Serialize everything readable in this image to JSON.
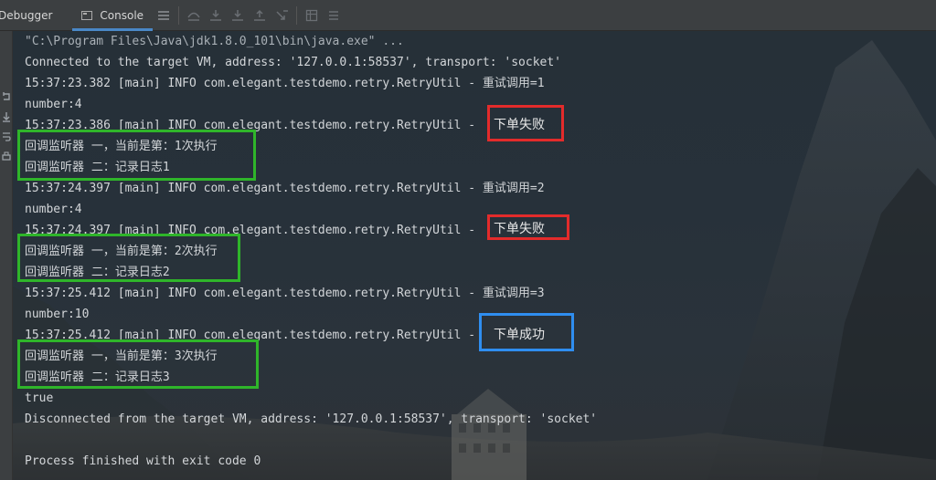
{
  "tabs": {
    "debugger": "Debugger",
    "console": "Console"
  },
  "toolbar_icons": [
    "menu-icon",
    "step-over-icon",
    "step-into-icon",
    "force-step-into-icon",
    "step-out-icon",
    "run-to-cursor-icon",
    "evaluate-icon",
    "frames-icon"
  ],
  "console": {
    "lines": [
      "\"C:\\Program Files\\Java\\jdk1.8.0_101\\bin\\java.exe\" ...",
      "Connected to the target VM, address: '127.0.0.1:58537', transport: 'socket'",
      "15:37:23.382 [main] INFO com.elegant.testdemo.retry.RetryUtil - 重试调用=1",
      "number:4",
      "15:37:23.386 [main] INFO com.elegant.testdemo.retry.RetryUtil -",
      "回调监听器 一，当前是第：1次执行",
      "回调监听器 二：记录日志1",
      "15:37:24.397 [main] INFO com.elegant.testdemo.retry.RetryUtil - 重试调用=2",
      "number:4",
      "15:37:24.397 [main] INFO com.elegant.testdemo.retry.RetryUtil -",
      "回调监听器 一，当前是第：2次执行",
      "回调监听器 二：记录日志2",
      "15:37:25.412 [main] INFO com.elegant.testdemo.retry.RetryUtil - 重试调用=3",
      "number:10",
      "15:37:25.412 [main] INFO com.elegant.testdemo.retry.RetryUtil -",
      "回调监听器 一，当前是第：3次执行",
      "回调监听器 二：记录日志3",
      "true",
      "Disconnected from the target VM, address: '127.0.0.1:58537', transport: 'socket'",
      "",
      "Process finished with exit code 0"
    ],
    "annotations": {
      "fail1": "下单失败",
      "fail2": "下单失败",
      "success": "下单成功"
    }
  },
  "colors": {
    "fail_box": "#e32b2b",
    "success_box": "#2f8ef0",
    "listener_box": "#2fb52a"
  },
  "gutter_icons": [
    "rerun-icon",
    "scroll-down-icon",
    "soft-wrap-icon",
    "print-icon",
    "clear-icon"
  ]
}
